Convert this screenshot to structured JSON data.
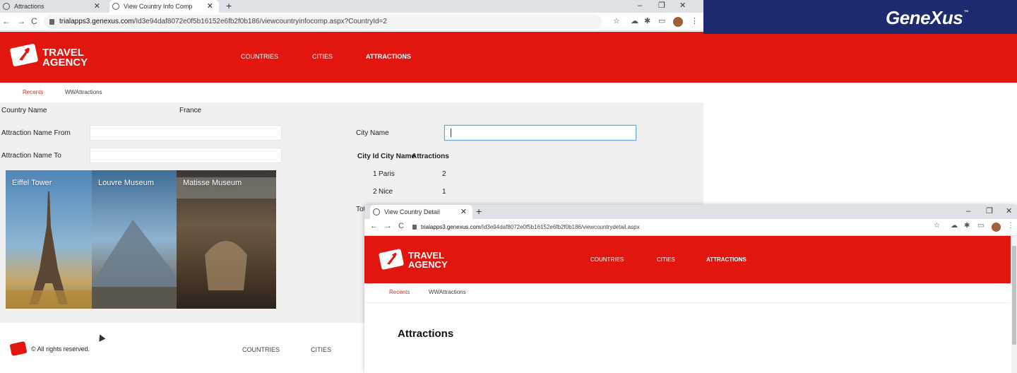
{
  "browser1": {
    "tabs": [
      {
        "title": "Attractions",
        "active": false
      },
      {
        "title": "View Country Info Comp",
        "active": true
      }
    ],
    "new_tab_label": "+",
    "window_controls": {
      "minimize": "–",
      "restore": "❐",
      "close": "✕"
    },
    "nav": {
      "back": "←",
      "forward": "→",
      "reload": "C"
    },
    "address": {
      "host": "trialapps3.genexus.com",
      "path": "/Id3e94daf8072e0f5b16152e6fb2f0b186/viewcountryinfocomp.aspx?CountryId=2"
    },
    "toolbar_icons": [
      "star-icon",
      "cloud-icon",
      "puzzle-icon",
      "cast-icon",
      "profile-avatar",
      "more-icon"
    ]
  },
  "app": {
    "brand_line1": "TRAVEL",
    "brand_line2": "AGENCY",
    "menu": [
      "COUNTRIES",
      "CITIES",
      "ATTRACTIONS"
    ],
    "active_menu": "ATTRACTIONS",
    "subnav": [
      "Recents",
      "WWAttractions"
    ],
    "colors": {
      "header_red": "#e3150f",
      "recents_red": "#c0392b",
      "content_bg": "#f0f0f0",
      "gx_blue": "#1e2a6e"
    }
  },
  "form": {
    "country_name_label": "Country Name",
    "country_name_value": "France",
    "attraction_from_label": "Attraction Name From",
    "attraction_to_label": "Attraction Name To",
    "city_name_label": "City Name",
    "total_label_partial": "Tot"
  },
  "cities_table": {
    "headers": [
      "City Id",
      "City Name",
      "Attractions"
    ],
    "rows": [
      {
        "id": "1",
        "name": "Paris",
        "attractions": "2"
      },
      {
        "id": "2",
        "name": "Nice",
        "attractions": "1"
      }
    ]
  },
  "attraction_photos": [
    {
      "caption": "Eiffel Tower",
      "icon": "eiffel-tower-photo"
    },
    {
      "caption": "Louvre Museum",
      "icon": "louvre-pyramid-photo"
    },
    {
      "caption": "Matisse Museum",
      "icon": "museum-hall-photo"
    }
  ],
  "footer": {
    "copyright": "© All rights reserved.",
    "links": [
      "COUNTRIES",
      "CITIES"
    ]
  },
  "genexus": {
    "logo_text": "GeneXus",
    "tm": "™"
  },
  "browser2": {
    "tab_title": "View Country Detail",
    "new_tab_label": "+",
    "window_controls": {
      "minimize": "–",
      "restore": "❐",
      "close": "✕"
    },
    "nav": {
      "back": "←",
      "forward": "→",
      "reload": "C"
    },
    "address": {
      "host": "trialapps3.genexus.com",
      "path": "/Id3e94daf8072e0f5b16152e6fb2f0b186/viewcountrydetail.aspx"
    },
    "page_heading": "Attractions"
  }
}
